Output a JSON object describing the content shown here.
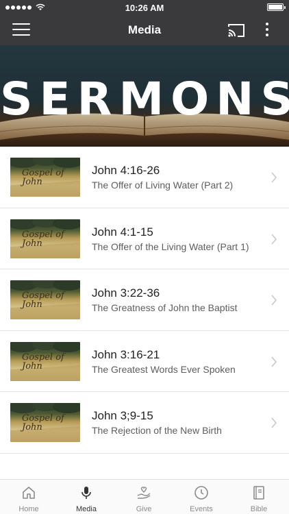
{
  "status_bar": {
    "time": "10:26 AM"
  },
  "app_bar": {
    "title": "Media"
  },
  "banner": {
    "text": "SERMONS"
  },
  "sermons": [
    {
      "thumb_text": "Gospel of John",
      "title": "John 4:16-26",
      "subtitle": "The Offer of Living Water (Part 2)"
    },
    {
      "thumb_text": "Gospel of John",
      "title": "John 4:1-15",
      "subtitle": "The Offer of the Living Water (Part 1)"
    },
    {
      "thumb_text": "Gospel of John",
      "title": "John 3:22-36",
      "subtitle": "The Greatness of John the Baptist"
    },
    {
      "thumb_text": "Gospel of John",
      "title": "John 3:16-21",
      "subtitle": "The Greatest Words Ever Spoken"
    },
    {
      "thumb_text": "Gospel of John",
      "title": "John 3;9-15",
      "subtitle": "The Rejection of the New Birth"
    }
  ],
  "tabs": [
    {
      "label": "Home",
      "icon": "home-icon"
    },
    {
      "label": "Media",
      "icon": "microphone-icon"
    },
    {
      "label": "Give",
      "icon": "give-icon"
    },
    {
      "label": "Events",
      "icon": "clock-icon"
    },
    {
      "label": "Bible",
      "icon": "book-icon"
    }
  ],
  "colors": {
    "app_bar": "#3a3a3c",
    "active_tab": "#333333",
    "inactive_tab": "#8a8a8a"
  }
}
